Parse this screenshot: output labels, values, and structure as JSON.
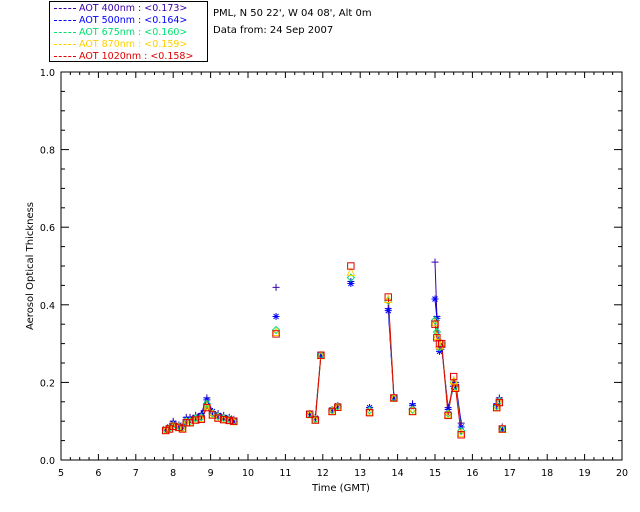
{
  "legend": [
    {
      "label": "AOT  400nm : <0.173>",
      "color": "#3a00a8"
    },
    {
      "label": "AOT  500nm : <0.164>",
      "color": "#0000ff"
    },
    {
      "label": "AOT  675nm : <0.160>",
      "color": "#00e070"
    },
    {
      "label": "AOT  870nm : <0.159>",
      "color": "#ffd000"
    },
    {
      "label": "AOT 1020nm : <0.158>",
      "color": "#e00000"
    }
  ],
  "info": {
    "site": "PML, N 50 22', W 04 08', Alt 0m",
    "date": "Data from: 24 Sep 2007"
  },
  "chart_data": {
    "type": "scatter",
    "xlabel": "Time (GMT)",
    "ylabel": "Aerosol Optical Thickness",
    "xlim": [
      5,
      20
    ],
    "ylim": [
      0.0,
      1.0
    ],
    "xticks": [
      "5",
      "6",
      "7",
      "8",
      "9",
      "10",
      "11",
      "12",
      "13",
      "14",
      "15",
      "16",
      "17",
      "18",
      "19",
      "20"
    ],
    "yticks": [
      "0.0",
      "0.2",
      "0.4",
      "0.6",
      "0.8",
      "1.0"
    ],
    "grid": false,
    "x": [
      7.8,
      7.9,
      8.0,
      8.15,
      8.25,
      8.35,
      8.45,
      8.6,
      8.75,
      8.9,
      9.05,
      9.2,
      9.35,
      9.5,
      9.62,
      10.75,
      11.65,
      11.8,
      11.95,
      12.25,
      12.4,
      12.75,
      13.25,
      13.75,
      13.9,
      14.4,
      15.0,
      15.05,
      15.12,
      15.18,
      15.35,
      15.5,
      15.55,
      15.7,
      16.65,
      16.72,
      16.8
    ],
    "segments": [
      [
        0,
        14
      ],
      [
        16,
        18
      ],
      [
        19,
        20
      ],
      [
        23,
        24
      ],
      [
        26,
        33
      ]
    ],
    "series": [
      {
        "name": "AOT  400nm : <0.173>",
        "marker": "plus",
        "values": [
          0.08,
          0.085,
          0.1,
          0.09,
          0.085,
          0.11,
          0.11,
          0.115,
          0.12,
          0.16,
          0.125,
          0.12,
          0.115,
          0.11,
          0.105,
          0.445,
          0.12,
          0.11,
          0.27,
          0.13,
          0.14,
          0.46,
          0.135,
          0.39,
          0.165,
          0.145,
          0.51,
          0.37,
          0.285,
          0.29,
          0.135,
          0.19,
          0.2,
          0.095,
          0.145,
          0.16,
          0.085
        ]
      },
      {
        "name": "AOT  500nm : <0.164>",
        "marker": "asterisk",
        "values": [
          0.08,
          0.085,
          0.095,
          0.09,
          0.085,
          0.105,
          0.105,
          0.11,
          0.115,
          0.155,
          0.125,
          0.115,
          0.11,
          0.108,
          0.1,
          0.37,
          0.12,
          0.108,
          0.27,
          0.13,
          0.14,
          0.455,
          0.135,
          0.385,
          0.16,
          0.14,
          0.415,
          0.365,
          0.28,
          0.29,
          0.13,
          0.19,
          0.195,
          0.085,
          0.14,
          0.155,
          0.08
        ]
      },
      {
        "name": "AOT  675nm : <0.160>",
        "marker": "diamond",
        "values": [
          0.078,
          0.082,
          0.09,
          0.087,
          0.083,
          0.1,
          0.1,
          0.108,
          0.11,
          0.145,
          0.12,
          0.112,
          0.108,
          0.105,
          0.1,
          0.335,
          0.118,
          0.105,
          0.27,
          0.128,
          0.138,
          0.47,
          0.128,
          0.41,
          0.16,
          0.13,
          0.36,
          0.33,
          0.29,
          0.3,
          0.12,
          0.2,
          0.19,
          0.075,
          0.138,
          0.152,
          0.08
        ]
      },
      {
        "name": "AOT  870nm : <0.159>",
        "marker": "triangle",
        "values": [
          0.078,
          0.081,
          0.088,
          0.085,
          0.082,
          0.098,
          0.098,
          0.105,
          0.108,
          0.14,
          0.118,
          0.11,
          0.106,
          0.103,
          0.1,
          0.33,
          0.118,
          0.104,
          0.27,
          0.127,
          0.137,
          0.485,
          0.125,
          0.415,
          0.16,
          0.127,
          0.355,
          0.32,
          0.295,
          0.3,
          0.118,
          0.205,
          0.188,
          0.07,
          0.136,
          0.15,
          0.08
        ]
      },
      {
        "name": "AOT 1020nm : <0.158>",
        "marker": "square",
        "values": [
          0.076,
          0.08,
          0.087,
          0.084,
          0.08,
          0.096,
          0.096,
          0.103,
          0.105,
          0.135,
          0.116,
          0.108,
          0.104,
          0.102,
          0.1,
          0.325,
          0.118,
          0.103,
          0.27,
          0.125,
          0.136,
          0.5,
          0.122,
          0.42,
          0.16,
          0.125,
          0.35,
          0.315,
          0.3,
          0.3,
          0.115,
          0.215,
          0.185,
          0.065,
          0.135,
          0.148,
          0.08
        ]
      }
    ]
  }
}
